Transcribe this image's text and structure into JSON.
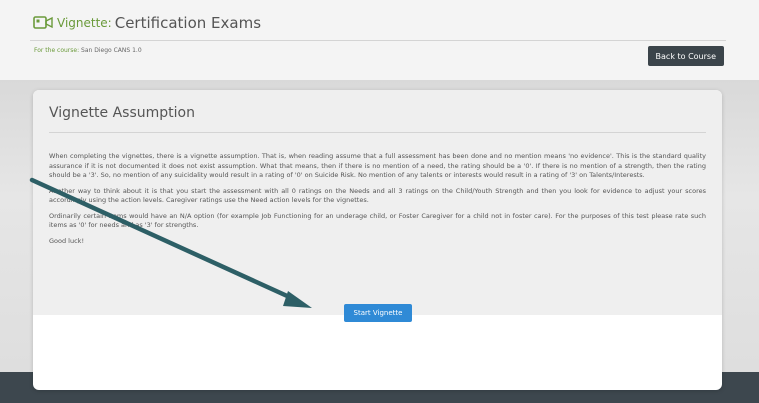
{
  "header": {
    "title_prefix": "Vignette:",
    "title": "Certification Exams",
    "course_label": "For the course:",
    "course_name": "San Diego CANS 1.0",
    "back_button": "Back to Course"
  },
  "card": {
    "title": "Vignette Assumption",
    "paragraphs": [
      "When completing the vignettes, there is a vignette assumption. That is, when reading assume that a full assessment has been done and no mention means 'no evidence'. This is the standard quality assurance if it is not documented it does not exist assumption. What that means, then if there is no mention of a need, the rating should be a '0'. If there is no mention of a strength, then the rating should be a '3'. So, no mention of any suicidality would result in a rating of '0' on Suicide Risk. No mention of any talents or interests would result in a rating of '3' on Talents/Interests.",
      "Another way to think about it is that you start the assessment with all 0 ratings on the Needs and all 3 ratings on the Child/Youth Strength and then you look for evidence to adjust your scores accordingly using the action levels. Caregiver ratings use the Need action levels for the vignettes.",
      "Ordinarily certain items would have an N/A option (for example Job Functioning for an underage child, or Foster Caregiver for a child not in foster care). For the purposes of this test please rate such items as '0' for needs and as '3' for strengths.",
      "Good luck!"
    ],
    "start_button": "Start Vignette"
  },
  "colors": {
    "accent_green": "#6a9a3a",
    "button_dark": "#3b444a",
    "button_blue": "#2f8ad6",
    "arrow": "#2d5f66",
    "footer": "#3d474e"
  },
  "icons": {
    "title_icon": "video-vignette-icon"
  }
}
